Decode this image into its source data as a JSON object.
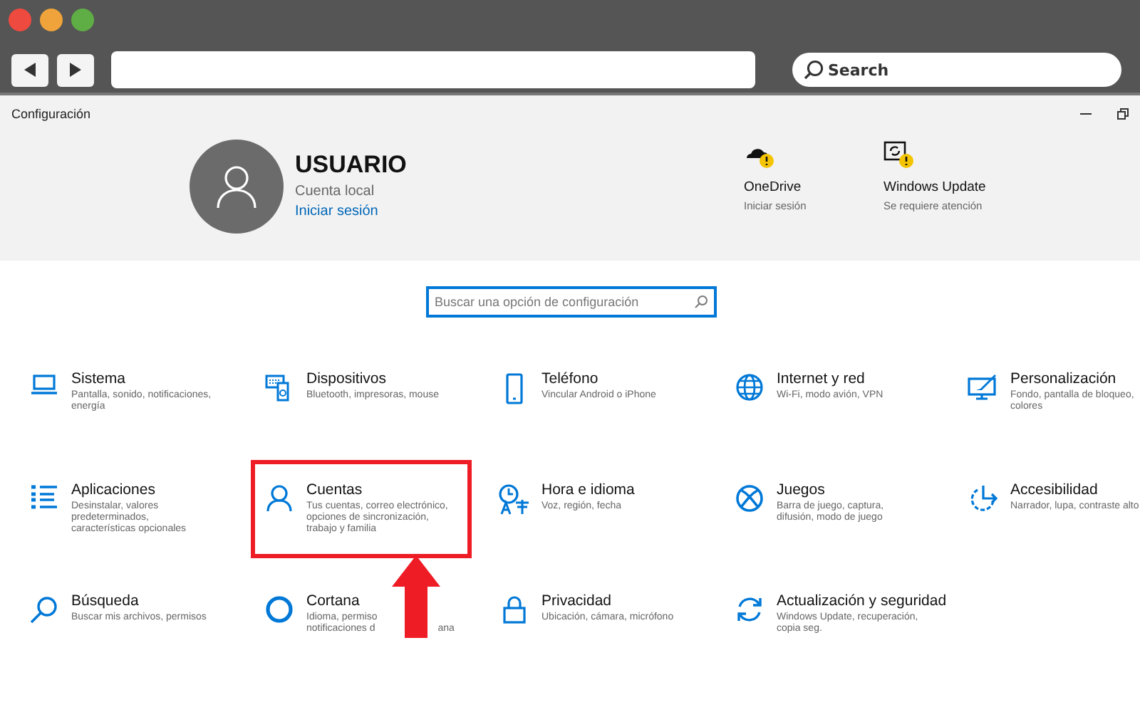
{
  "browser": {
    "search": {
      "placeholder": "Search"
    }
  },
  "window": {
    "title": "Configuración"
  },
  "account": {
    "name": "USUARIO",
    "type": "Cuenta local",
    "link": "Iniciar sesión"
  },
  "status": [
    {
      "title": "OneDrive",
      "subtitle": "Iniciar sesión"
    },
    {
      "title": "Windows Update",
      "subtitle": "Se requiere atención"
    }
  ],
  "search": {
    "placeholder": "Buscar una opción de configuración"
  },
  "categories": [
    {
      "title": "Sistema",
      "description": [
        [
          "Pantalla, sonido, notificaciones,"
        ],
        [
          "energía"
        ]
      ],
      "selected": false
    },
    {
      "title": "Dispositivos",
      "description": [
        [
          "Bluetooth, impresoras, mouse"
        ]
      ],
      "selected": false
    },
    {
      "title": "Teléfono",
      "description": [
        [
          "Vincular Android o iPhone"
        ]
      ],
      "selected": false
    },
    {
      "title": "Internet y red",
      "description": [
        [
          "Wi-Fi, modo avión, VPN"
        ]
      ],
      "selected": false
    },
    {
      "title": "Personalización",
      "description": [
        [
          "Fondo, pantalla de bloqueo,"
        ],
        [
          "colores"
        ]
      ],
      "selected": false
    },
    {
      "title": "Aplicaciones",
      "description": [
        [
          "Desinstalar, valores"
        ],
        [
          "predeterminados,"
        ],
        [
          "características opcionales"
        ]
      ],
      "selected": false
    },
    {
      "title": "Cuentas",
      "description": [
        [
          "Tus cuentas, correo electrónico,"
        ],
        [
          "opciones de sincronización,"
        ],
        [
          "trabajo y familia"
        ]
      ],
      "selected": true
    },
    {
      "title": "Hora e idioma",
      "description": [
        [
          "Voz, región, fecha"
        ]
      ],
      "selected": false
    },
    {
      "title": "Juegos",
      "description": [
        [
          "Barra de juego, captura,"
        ],
        [
          "difusión, modo de juego"
        ]
      ],
      "selected": false
    },
    {
      "title": "Accesibilidad",
      "description": [
        [
          "Narrador, lupa, contraste alto"
        ]
      ],
      "selected": false
    },
    {
      "title": "Búsqueda",
      "description": [
        [
          "Buscar mis archivos, permisos"
        ]
      ],
      "selected": false
    },
    {
      "title": "Cortana",
      "description": [
        [
          "Idioma, permiso"
        ],
        [
          "notificaciones d",
          "ana"
        ]
      ],
      "selected": false
    },
    {
      "title": "Privacidad",
      "description": [
        [
          "Ubicación, cámara, micrófono"
        ]
      ],
      "selected": false
    },
    {
      "title": "Actualización y seguridad",
      "description": [
        [
          "Windows Update, recuperación,"
        ],
        [
          "copia seg."
        ]
      ],
      "selected": false
    }
  ]
}
